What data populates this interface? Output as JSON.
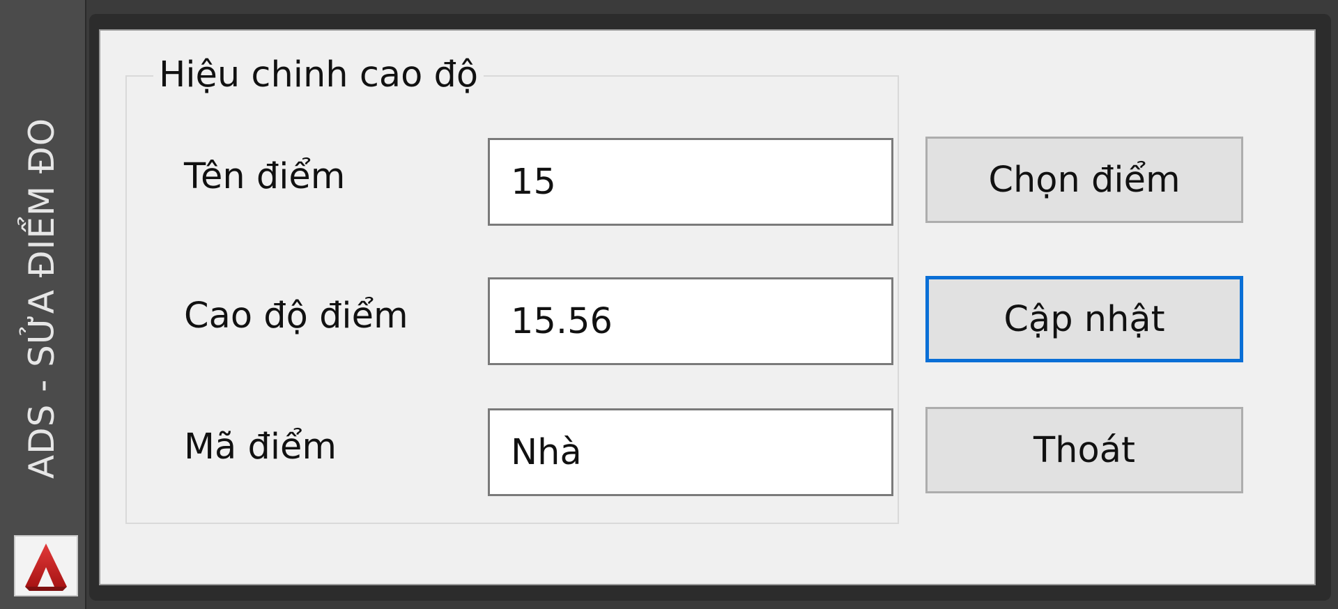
{
  "window": {
    "title": "ADS - SỬA ĐIỂM ĐO",
    "app_icon": "autocad-logo-icon",
    "accent_color": "#0a6fd6",
    "title_icon_color": "#c81e1e"
  },
  "group": {
    "title": "Hiệu chinh cao độ"
  },
  "fields": {
    "point_name": {
      "label": "Tên điểm",
      "value": "15"
    },
    "elevation": {
      "label": "Cao độ điểm",
      "value": "15.56"
    },
    "point_code": {
      "label": "Mã điểm",
      "value": "Nhà"
    }
  },
  "buttons": {
    "select_point": "Chọn điểm",
    "update": "Cập nhật",
    "exit": "Thoát"
  }
}
